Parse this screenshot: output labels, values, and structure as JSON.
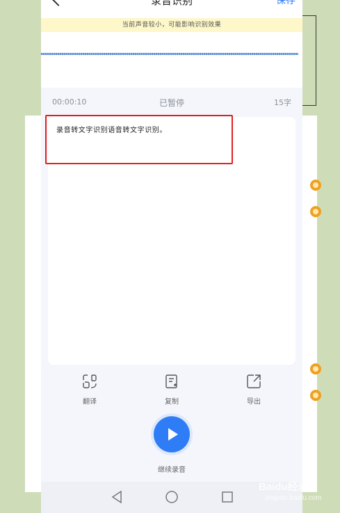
{
  "header": {
    "title": "录音识别",
    "save_label": "保存"
  },
  "warning": "当前声音较小，可能影响识别效果",
  "status": {
    "time": "00:00:10",
    "state": "已暂停",
    "char_count": "15字"
  },
  "transcript": "录音转文字识别语音转文字识别。",
  "actions": [
    {
      "label": "翻译",
      "icon": "translate-icon"
    },
    {
      "label": "复制",
      "icon": "copy-icon"
    },
    {
      "label": "导出",
      "icon": "export-icon"
    }
  ],
  "continue_label": "继续录音",
  "accent_color": "#2f7df6",
  "highlight_color": "#e02020",
  "watermark": {
    "brand": "Baidu经验",
    "sub": "jingyan.baidu.com"
  }
}
